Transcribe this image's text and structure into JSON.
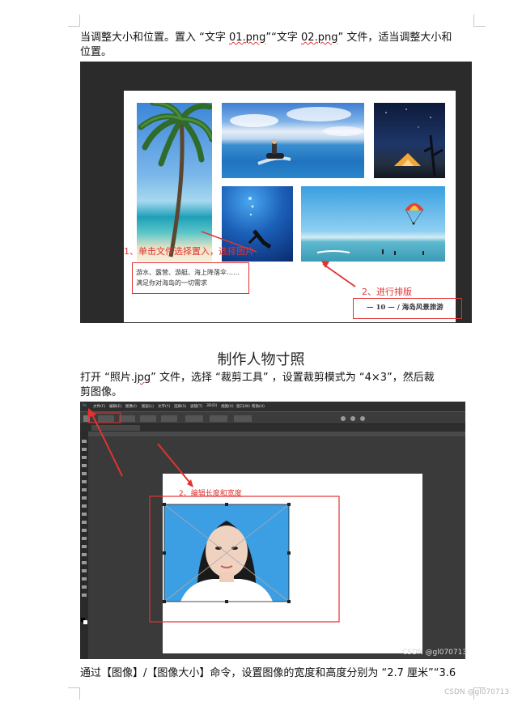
{
  "para1": {
    "line1_pre": "当调整大小和位置。置入 “文字 ",
    "file1": "01.png",
    "line1_mid": "”“文字 ",
    "file2": "02.png",
    "line1_post": "” 文件，适当调整大小和",
    "line2": "位置。"
  },
  "figure1": {
    "caption_line1": "游水、露营、游艇、海上降落伞……",
    "caption_line2": "满足你对海岛的一切需求",
    "annotation1": "1、单击文件选择置入，选择图片",
    "annotation2": "2、进行排版",
    "footer": "— 10 —  / 海岛风景旅游"
  },
  "heading": "制作人物寸照",
  "para2": {
    "line1_pre": "打开 “照片.",
    "file": "jpg",
    "line1_post": "” 文件，选择 “裁剪工具” ，设置裁剪模式为 “4×3”，然后裁",
    "line2": "剪图像。"
  },
  "figure2": {
    "menu_items": [
      "文件(F)",
      "编辑(E)",
      "图像(I)",
      "图层(L)",
      "文字(Y)",
      "选择(S)",
      "滤镜(T)",
      "3D(D)",
      "视图(V)",
      "窗口(W)",
      "帮助(H)"
    ],
    "annotation": "2、编辑长度和宽度",
    "watermark": "CSDN @gl070713"
  },
  "para3": "通过【图像】/【图像大小】命令，设置图像的宽度和高度分别为 “2.7 厘米”“3.6",
  "page_watermark": "CSDN @gl070713"
}
